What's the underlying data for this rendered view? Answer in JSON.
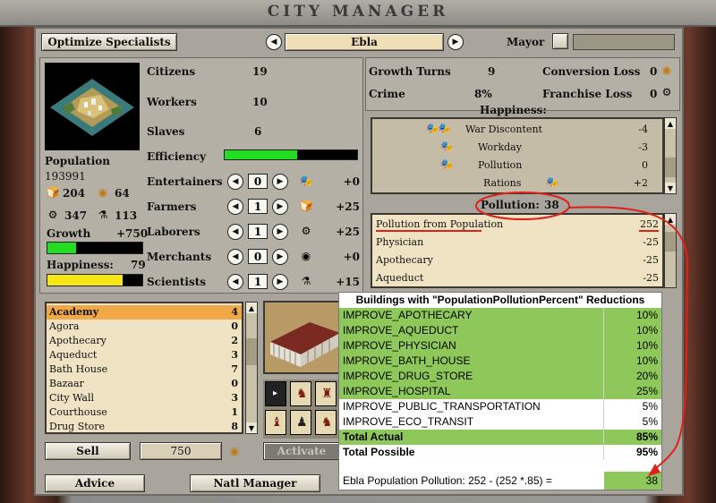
{
  "window_title": "CITY MANAGER",
  "header": {
    "optimize_label": "Optimize Specialists",
    "city_name": "Ebla",
    "mayor_label": "Mayor"
  },
  "stats": {
    "citizens_label": "Citizens",
    "citizens": "19",
    "workers_label": "Workers",
    "workers": "10",
    "slaves_label": "Slaves",
    "slaves": "6",
    "efficiency_label": "Efficiency",
    "efficiency_fraction": 0.55,
    "population_label": "Population",
    "population": "193991",
    "food": "204",
    "gold": "64",
    "production": "347",
    "science": "113",
    "growth_label": "Growth",
    "growth_value": "+750",
    "growth_fraction": 0.3,
    "happiness_label": "Happiness:",
    "happiness_value": "79",
    "happiness_fraction": 0.79
  },
  "specialists": [
    {
      "label": "Entertainers",
      "count": "0",
      "yield": "+0"
    },
    {
      "label": "Farmers",
      "count": "1",
      "yield": "+25"
    },
    {
      "label": "Laborers",
      "count": "1",
      "yield": "+25"
    },
    {
      "label": "Merchants",
      "count": "0",
      "yield": "+0"
    },
    {
      "label": "Scientists",
      "count": "1",
      "yield": "+15"
    }
  ],
  "right_stats": {
    "growth_turns_label": "Growth Turns",
    "growth_turns": "9",
    "conversion_loss_label": "Conversion Loss",
    "conversion_loss": "0",
    "crime_label": "Crime",
    "crime": "8%",
    "franchise_loss_label": "Franchise Loss",
    "franchise_loss": "0",
    "happiness_header": "Happiness:"
  },
  "happiness_list": [
    {
      "label": "War Discontent",
      "value": "-4"
    },
    {
      "label": "Workday",
      "value": "-3"
    },
    {
      "label": "Pollution",
      "value": "0"
    },
    {
      "label": "Rations",
      "value": "+2"
    }
  ],
  "pollution": {
    "label": "Pollution:",
    "value": "38"
  },
  "pollution_list": [
    {
      "label": "Pollution from Population",
      "value": "252"
    },
    {
      "label": "Physician",
      "value": "-25"
    },
    {
      "label": "Apothecary",
      "value": "-25"
    },
    {
      "label": "Aqueduct",
      "value": "-25"
    }
  ],
  "buildings": [
    {
      "label": "Academy",
      "value": "4"
    },
    {
      "label": "Agora",
      "value": "0"
    },
    {
      "label": "Apothecary",
      "value": "2"
    },
    {
      "label": "Aqueduct",
      "value": "3"
    },
    {
      "label": "Bath House",
      "value": "7"
    },
    {
      "label": "Bazaar",
      "value": "0"
    },
    {
      "label": "City Wall",
      "value": "3"
    },
    {
      "label": "Courthouse",
      "value": "1"
    },
    {
      "label": "Drug Store",
      "value": "8"
    }
  ],
  "bottom": {
    "sell_label": "Sell",
    "sell_value": "750",
    "activate_label": "Activate",
    "advice_label": "Advice",
    "natl_label": "Natl Manager"
  },
  "overlay": {
    "title": "Buildings with \"PopulationPollutionPercent\" Reductions",
    "rows": [
      {
        "name": "IMPROVE_APOTHECARY",
        "pct": "10%",
        "green": true
      },
      {
        "name": "IMPROVE_AQUEDUCT",
        "pct": "10%",
        "green": true
      },
      {
        "name": "IMPROVE_PHYSICIAN",
        "pct": "10%",
        "green": true
      },
      {
        "name": "IMPROVE_BATH_HOUSE",
        "pct": "10%",
        "green": true
      },
      {
        "name": "IMPROVE_DRUG_STORE",
        "pct": "20%",
        "green": true
      },
      {
        "name": "IMPROVE_HOSPITAL",
        "pct": "25%",
        "green": true
      },
      {
        "name": "IMPROVE_PUBLIC_TRANSPORTATION",
        "pct": "5%",
        "green": false
      },
      {
        "name": "IMPROVE_ECO_TRANSIT",
        "pct": "5%",
        "green": false
      }
    ],
    "total_actual_label": "Total Actual",
    "total_actual": "85%",
    "total_possible_label": "Total Possible",
    "total_possible": "95%",
    "formula": "Ebla Population Pollution: 252 - (252 *.85) =",
    "result": "38"
  },
  "colors": {
    "green_bar": "#22dd22",
    "yellow_bar": "#f5e614",
    "highlight": "#f0a848",
    "annotation": "#e0201a",
    "table_green": "#8fc85a"
  }
}
